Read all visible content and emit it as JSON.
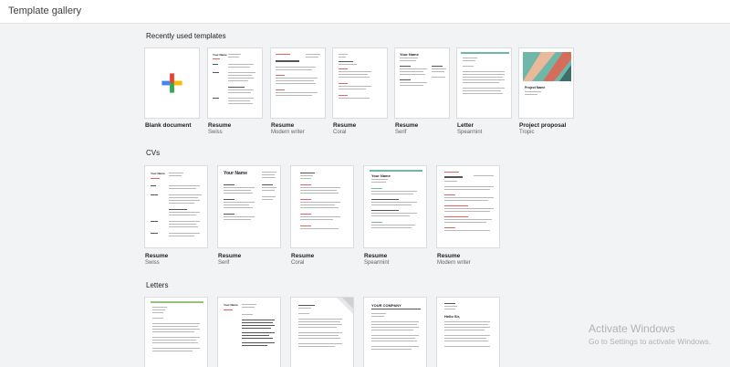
{
  "header": {
    "title": "Template gallery"
  },
  "sections": {
    "recent": {
      "title": "Recently used templates",
      "items": [
        {
          "name": "Blank document",
          "sub": ""
        },
        {
          "name": "Resume",
          "sub": "Swiss"
        },
        {
          "name": "Resume",
          "sub": "Modern writer"
        },
        {
          "name": "Resume",
          "sub": "Coral"
        },
        {
          "name": "Resume",
          "sub": "Serif"
        },
        {
          "name": "Letter",
          "sub": "Spearmint"
        },
        {
          "name": "Project proposal",
          "sub": "Tropic"
        }
      ]
    },
    "cvs": {
      "title": "CVs",
      "items": [
        {
          "name": "Resume",
          "sub": "Swiss"
        },
        {
          "name": "Resume",
          "sub": "Serif"
        },
        {
          "name": "Resume",
          "sub": "Coral"
        },
        {
          "name": "Resume",
          "sub": "Spearmint"
        },
        {
          "name": "Resume",
          "sub": "Modern writer"
        }
      ]
    },
    "letters": {
      "title": "Letters"
    }
  },
  "thumb_text": {
    "your_name": "Your Name",
    "your_company": "YOUR COMPANY",
    "project_name": "Project Name",
    "hello": "Hello Sir,"
  },
  "watermark": {
    "line1": "Activate Windows",
    "line2": "Go to Settings to activate Windows."
  },
  "colors": {
    "plus_red": "#ea4335",
    "plus_blue": "#4285f4",
    "plus_green": "#34a853",
    "plus_yellow": "#fbbc04"
  }
}
